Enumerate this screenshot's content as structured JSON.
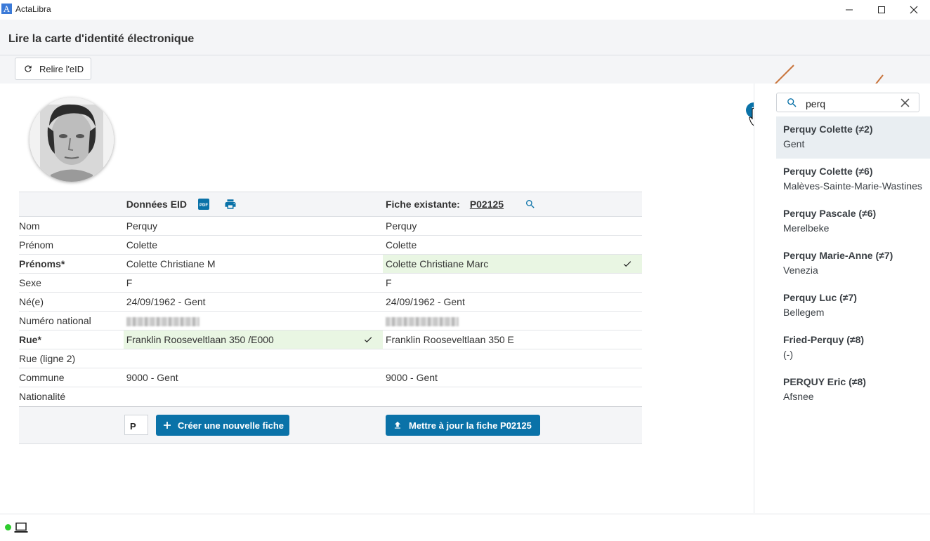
{
  "app": {
    "logo_letter": "A",
    "name": "ActaLibra"
  },
  "page_title": "Lire la carte d'identité électronique",
  "toolbar": {
    "reload_label": "Relire l'eID"
  },
  "table": {
    "eid_header": "Données EID",
    "existing_header": "Fiche existante:",
    "existing_id": "P02125",
    "rows": [
      {
        "label": "Nom",
        "eid": "Perquy",
        "existing": "Perquy"
      },
      {
        "label": "Prénom",
        "eid": "Colette",
        "existing": "Colette"
      },
      {
        "label": "Prénoms*",
        "eid": "Colette Christiane M",
        "existing": "Colette Christiane Marc"
      },
      {
        "label": "Sexe",
        "eid": "F",
        "existing": "F"
      },
      {
        "label": "Né(e)",
        "eid": "24/09/1962 - Gent",
        "existing": "24/09/1962 - Gent"
      },
      {
        "label": "Numéro national",
        "eid": "",
        "existing": ""
      },
      {
        "label": "Rue*",
        "eid": "Franklin Rooseveltlaan 350 /E000",
        "existing": "Franklin Rooseveltlaan 350 E"
      },
      {
        "label": "Rue (ligne 2)",
        "eid": "",
        "existing": ""
      },
      {
        "label": "Commune",
        "eid": "9000 - Gent",
        "existing": "9000 - Gent"
      },
      {
        "label": "Nationalité",
        "eid": "",
        "existing": ""
      }
    ],
    "prefix_value": "P",
    "create_label": "Créer une nouvelle fiche",
    "update_label": "Mettre à jour la fiche P02125"
  },
  "search": {
    "value": "perq",
    "results": [
      {
        "name": "Perquy Colette (≠2)",
        "city": "Gent"
      },
      {
        "name": "Perquy Colette (≠6)",
        "city": "Malèves-Sainte-Marie-Wastines"
      },
      {
        "name": "Perquy Pascale (≠6)",
        "city": "Merelbeke"
      },
      {
        "name": "Perquy Marie-Anne (≠7)",
        "city": "Venezia"
      },
      {
        "name": "Perquy Luc (≠7)",
        "city": "Bellegem"
      },
      {
        "name": "Fried-Perquy (≠8)",
        "city": "(-)"
      },
      {
        "name": "PERQUY Eric (≠8)",
        "city": "Afsnee"
      }
    ]
  },
  "icons": {
    "accent": "#0a72a8",
    "match_bg": "#e9f6e3"
  }
}
